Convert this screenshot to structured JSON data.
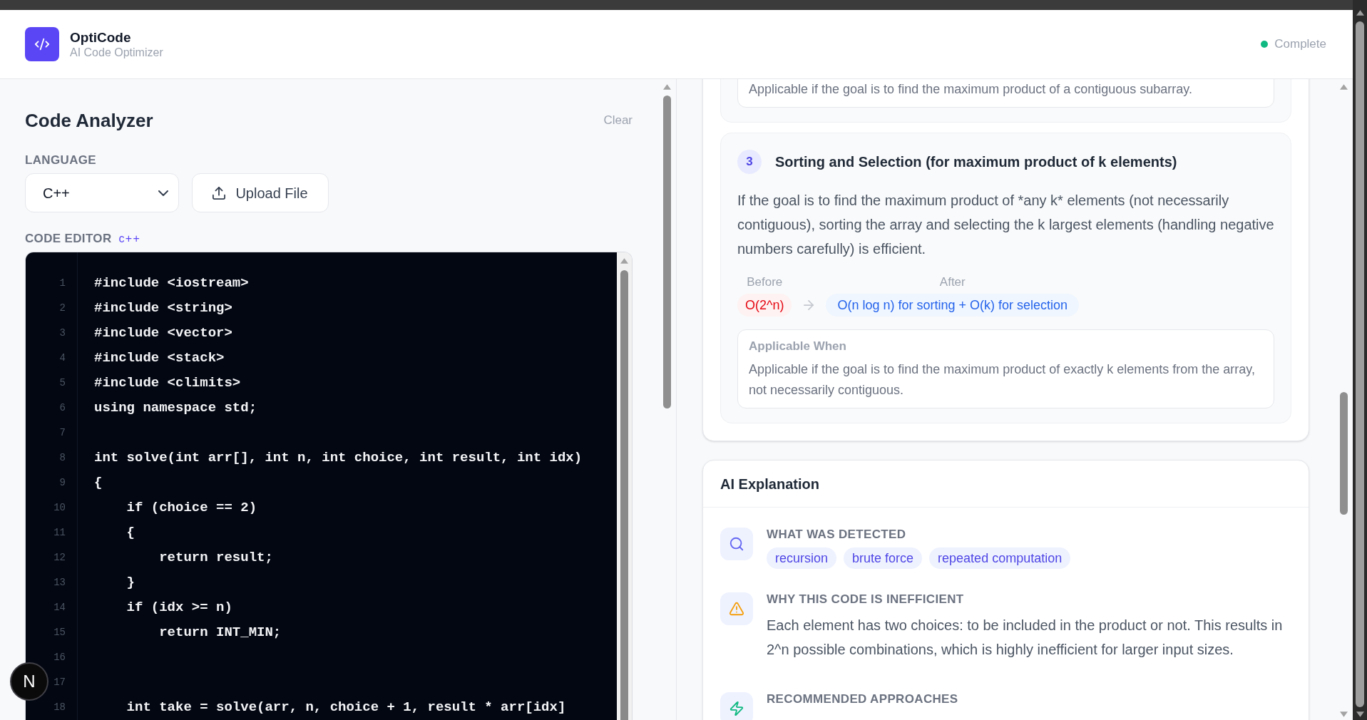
{
  "header": {
    "app_name": "OptiCode",
    "tagline": "AI Code Optimizer",
    "status": {
      "label": "Complete",
      "kind": "complete"
    }
  },
  "analyzer": {
    "title": "Code Analyzer",
    "clear_button": "Clear",
    "language_label": "LANGUAGE",
    "language_select": {
      "value": "C++"
    },
    "upload_button": {
      "label": "Upload File"
    },
    "editor_label": "CODE EDITOR",
    "editor_language": "c++",
    "code_lines": [
      {
        "number": "1",
        "text": "#include <iostream>"
      },
      {
        "number": "2",
        "text": "#include <string>"
      },
      {
        "number": "3",
        "text": "#include <vector>"
      },
      {
        "number": "4",
        "text": "#include <stack>"
      },
      {
        "number": "5",
        "text": "#include <climits>"
      },
      {
        "number": "6",
        "text": "using namespace std;"
      },
      {
        "number": "7"
      },
      {
        "number": "8",
        "text": "int solve(int arr[], int n, int choice, int result, int idx)"
      },
      {
        "number": "9",
        "text": "{"
      },
      {
        "number": "10",
        "text": "    if (choice == 2)"
      },
      {
        "number": "11",
        "text": "    {"
      },
      {
        "number": "12",
        "text": "        return result;"
      },
      {
        "number": "13",
        "text": "    }"
      },
      {
        "number": "14",
        "text": "    if (idx >= n)"
      },
      {
        "number": "15",
        "text": "        return INT_MIN;"
      },
      {
        "number": "16"
      },
      {
        "number": "17"
      },
      {
        "number": "18",
        "text": "    int take = solve(arr, n, choice + 1, result * arr[idx]"
      }
    ]
  },
  "approaches": [
    {
      "applicable_text": "Applicable if the goal is to find the maximum product of a contiguous subarray."
    },
    {
      "number": "3",
      "title": "Sorting and Selection (for maximum product of k elements)",
      "description": "If the goal is to find the maximum product of *any k* elements (not necessarily contiguous), sorting the array and selecting the k largest elements (handling negative numbers carefully) is efficient.",
      "before_label": "Before",
      "before": "O(2^n)",
      "after_label": "After",
      "after": "O(n log n) for sorting + O(k) for selection",
      "applicable_label": "Applicable When",
      "applicable_text": "Applicable if the goal is to find the maximum product of exactly k elements from the array, not necessarily contiguous."
    }
  ],
  "ai_explanation": {
    "title": "AI Explanation",
    "sections": [
      {
        "kind": "tags",
        "heading": "WHAT WAS DETECTED",
        "tags": [
          "recursion",
          "brute force",
          "repeated computation"
        ]
      },
      {
        "kind": "text",
        "heading": "WHY THIS CODE IS INEFFICIENT",
        "text": "Each element has two choices: to be included in the product or not. This results in 2^n possible combinations, which is highly inefficient for larger input sizes."
      },
      {
        "kind": "approaches",
        "heading": "RECOMMENDED APPROACHES"
      }
    ]
  },
  "dev_indicator": {
    "label": "N"
  }
}
